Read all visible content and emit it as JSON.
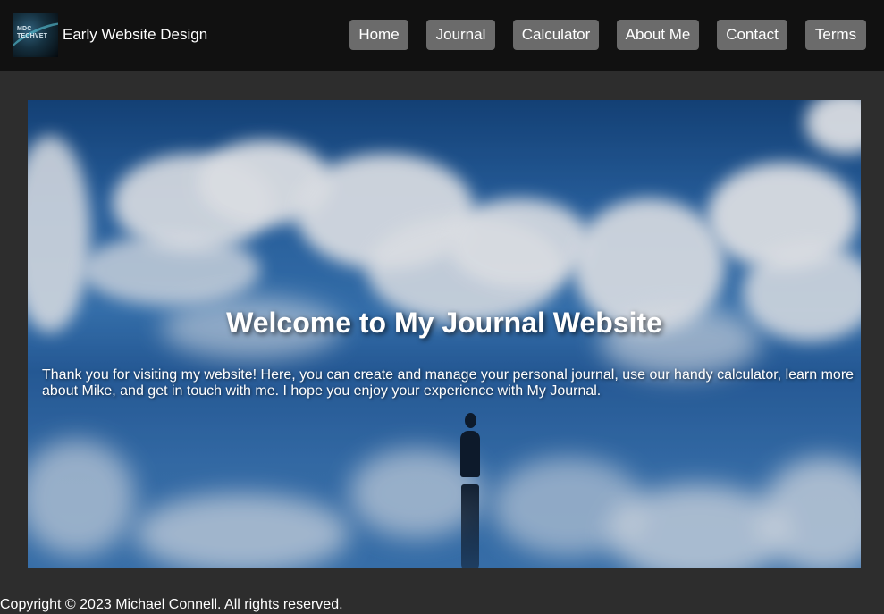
{
  "header": {
    "logo_text_line1": "MDC",
    "logo_text_line2": "TECHVET",
    "site_title": "Early Website Design"
  },
  "nav": {
    "items": [
      {
        "label": "Home"
      },
      {
        "label": "Journal"
      },
      {
        "label": "Calculator"
      },
      {
        "label": "About Me"
      },
      {
        "label": "Contact"
      },
      {
        "label": "Terms"
      }
    ]
  },
  "hero": {
    "title": "Welcome to My Journal Website",
    "text": "Thank you for visiting my website! Here, you can create and manage your personal journal, use our handy calculator, learn more about Mike, and get in touch with me. I hope you enjoy your experience with My Journal.",
    "background_image": "sky-clouds-reflection-with-standing-figure"
  },
  "footer": {
    "copyright": "Copyright © 2023 Michael Connell. All rights reserved."
  },
  "colors": {
    "page_background": "#2d2d2d",
    "topbar_background": "#111111",
    "nav_button_background": "#6b6b6b",
    "text": "#ffffff"
  }
}
